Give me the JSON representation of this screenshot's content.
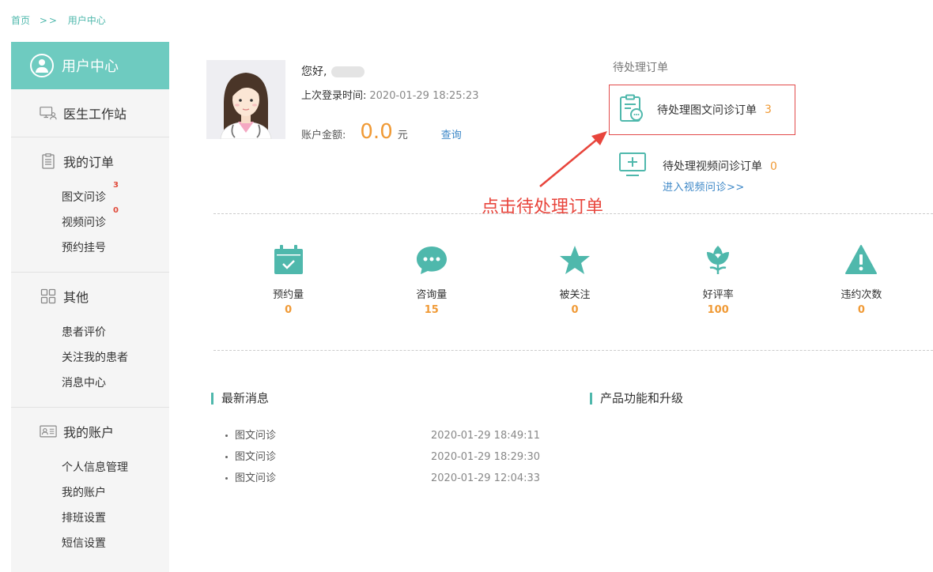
{
  "breadcrumb": {
    "home": "首页",
    "sep": ">>",
    "current": "用户中心"
  },
  "sidebar": {
    "header": "用户中心",
    "sections": [
      {
        "title": "医生工作站",
        "icon": "workstation-icon"
      },
      {
        "title": "我的订单",
        "icon": "clipboard-icon",
        "items": [
          {
            "label": "图文问诊",
            "badge": "3"
          },
          {
            "label": "视频问诊",
            "badge": "0"
          },
          {
            "label": "预约挂号"
          }
        ]
      },
      {
        "title": "其他",
        "icon": "grid-icon",
        "items": [
          {
            "label": "患者评价"
          },
          {
            "label": "关注我的患者"
          },
          {
            "label": "消息中心"
          }
        ]
      },
      {
        "title": "我的账户",
        "icon": "id-card-icon",
        "items": [
          {
            "label": "个人信息管理"
          },
          {
            "label": "我的账户"
          },
          {
            "label": "排班设置"
          },
          {
            "label": "短信设置"
          }
        ]
      }
    ]
  },
  "profile": {
    "greeting": "您好,",
    "last_login_label": "上次登录时间:",
    "last_login_value": "2020-01-29 18:25:23",
    "balance_label": "账户金额:",
    "balance_value": "0.0",
    "balance_unit": "元",
    "query_label": "查询"
  },
  "pending": {
    "title": "待处理订单",
    "text_order_label": "待处理图文问诊订单",
    "text_order_count": "3",
    "video_order_label": "待处理视频问诊订单",
    "video_order_count": "0",
    "enter_video_label": "进入视频问诊>>"
  },
  "annotation": "点击待处理订单",
  "stats": [
    {
      "label": "预约量",
      "value": "0",
      "icon": "calendar-icon"
    },
    {
      "label": "咨询量",
      "value": "15",
      "icon": "chat-bubble-icon"
    },
    {
      "label": "被关注",
      "value": "0",
      "icon": "star-icon"
    },
    {
      "label": "好评率",
      "value": "100",
      "icon": "flower-icon"
    },
    {
      "label": "违约次数",
      "value": "0",
      "icon": "warning-icon"
    }
  ],
  "news": {
    "title": "最新消息",
    "items": [
      {
        "title": "图文问诊",
        "date": "2020-01-29 18:49:11"
      },
      {
        "title": "图文问诊",
        "date": "2020-01-29 18:29:30"
      },
      {
        "title": "图文问诊",
        "date": "2020-01-29 12:04:33"
      }
    ]
  },
  "upgrades": {
    "title": "产品功能和升级"
  },
  "colors": {
    "teal": "#6ecbc0",
    "accent_orange": "#f09a36",
    "link_blue": "#3c87c7",
    "annotation_red": "#e8453c"
  }
}
